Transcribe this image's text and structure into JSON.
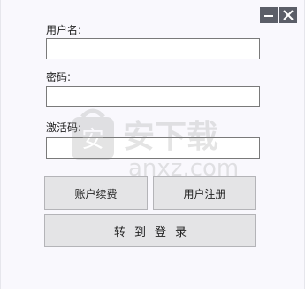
{
  "window": {
    "controls": {
      "minimize_icon": "minimize-icon",
      "close_icon": "close-icon"
    }
  },
  "form": {
    "username_label": "用户名:",
    "username_value": "",
    "password_label": "密码:",
    "password_value": "",
    "activation_label": "激活码:",
    "activation_value": ""
  },
  "buttons": {
    "renew_label": "账户续费",
    "register_label": "用户注册",
    "login_label": "转到登录"
  },
  "watermark": {
    "brand_text": "安下载",
    "domain_text": "anxz.com",
    "shield_char": "安"
  },
  "colors": {
    "control_bg": "#5b5e68",
    "button_bg": "#e4e4e6",
    "window_bg": "#f9f8fd"
  }
}
